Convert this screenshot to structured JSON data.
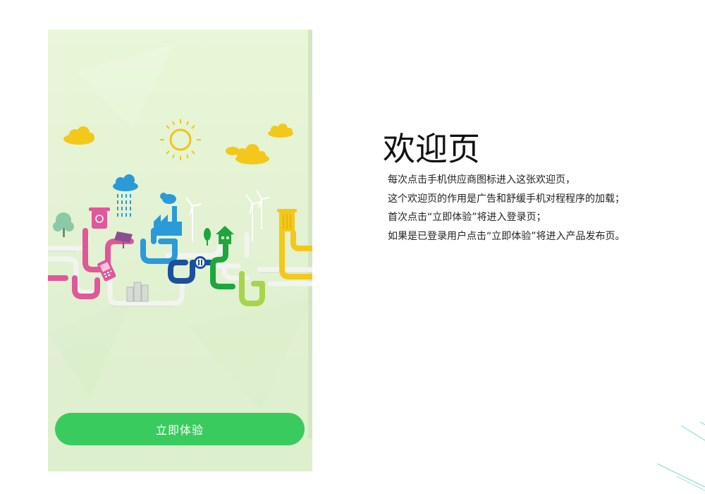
{
  "phone": {
    "cta_label": "立即体验"
  },
  "page": {
    "title": "欢迎页",
    "description": [
      "每次点击手机供应商图标进入这张欢迎页，",
      "这个欢迎页的作用是广告和舒缓手机对程程序的加载；",
      "首次点击“立即体验”将进入登录页；",
      "如果是已登录用户点击“立即体验”将进入产品发布页。"
    ]
  },
  "colors": {
    "cta": "#3acb5e",
    "background": "#e9f7d9",
    "sun": "#f2c512",
    "pink": "#e0579a",
    "blue": "#2a9ad8",
    "navy": "#1c4f9c",
    "green": "#1ea63c",
    "lime": "#a8d44a",
    "yellow": "#f4c81a"
  }
}
